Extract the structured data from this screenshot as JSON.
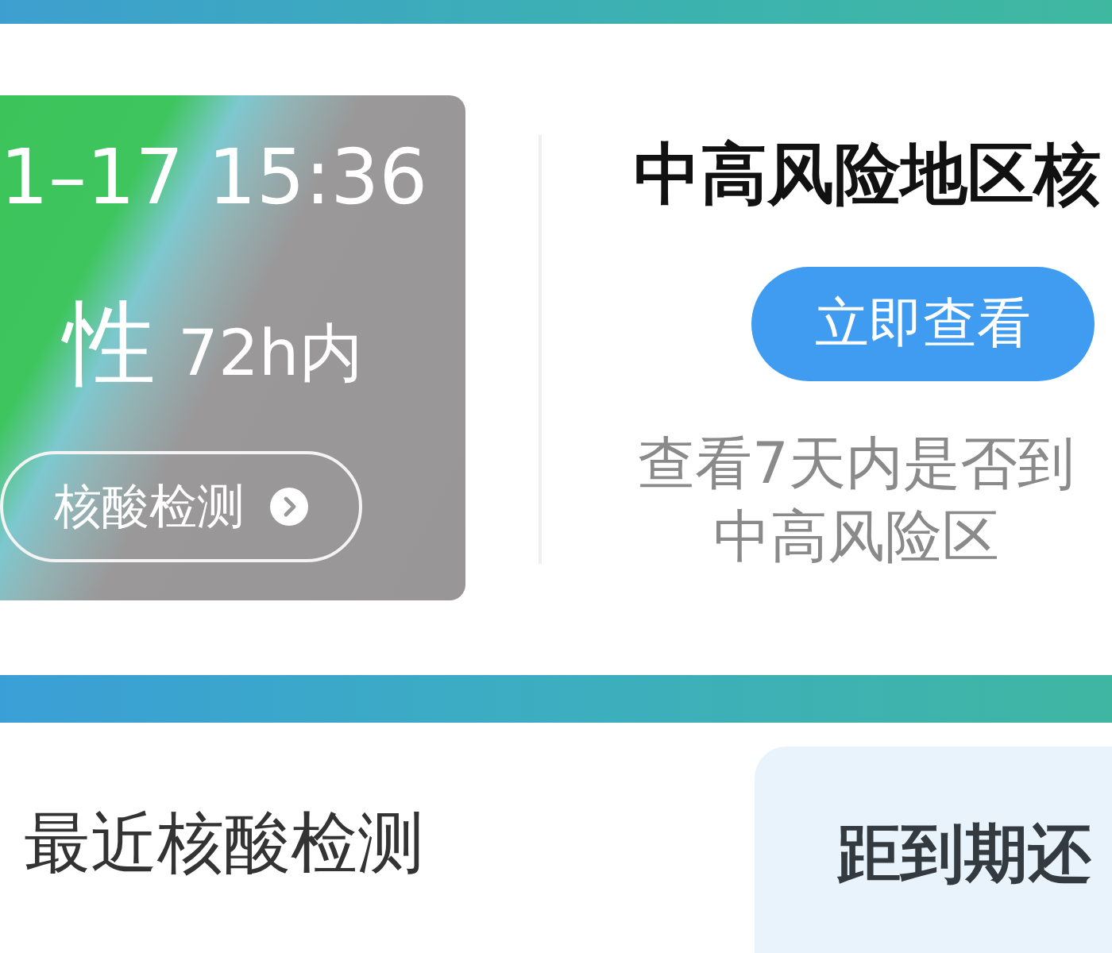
{
  "health_code_card": {
    "time": "1–17 15:36",
    "result": "性",
    "validity": "72h内",
    "button": "核酸检测"
  },
  "risk_area": {
    "title": "中高风险地区核",
    "button": "立即查看",
    "description": [
      "查看7天内是否到",
      "中高风险区"
    ]
  },
  "recent_test": {
    "title": "最近核酸检测"
  },
  "expiry_card": {
    "title": "距到期还"
  }
}
